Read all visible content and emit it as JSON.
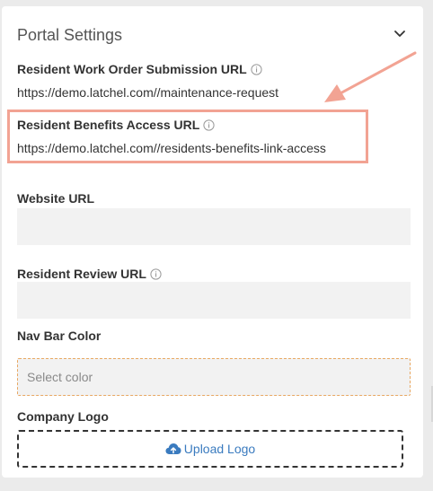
{
  "panel": {
    "title": "Portal Settings",
    "toggle_icon": "chevron-down-icon"
  },
  "fields": {
    "work_order_url": {
      "label": "Resident Work Order Submission URL",
      "value": "https://demo.latchel.com//maintenance-request",
      "info_icon": "info-icon"
    },
    "benefits_url": {
      "label": "Resident Benefits Access URL",
      "value": "https://demo.latchel.com//residents-benefits-link-access",
      "info_icon": "info-icon"
    },
    "website_url": {
      "label": "Website URL",
      "value": ""
    },
    "review_url": {
      "label": "Resident Review URL",
      "value": "",
      "info_icon": "info-icon"
    },
    "nav_bar_color": {
      "label": "Nav Bar Color",
      "placeholder": "Select color"
    },
    "company_logo": {
      "label": "Company Logo",
      "upload_label": "Upload Logo",
      "upload_icon": "cloud-upload-icon"
    }
  },
  "colors": {
    "highlight": "#f2a393",
    "accent_link": "#3a7bbf",
    "dashed_border": "#e8a862"
  }
}
